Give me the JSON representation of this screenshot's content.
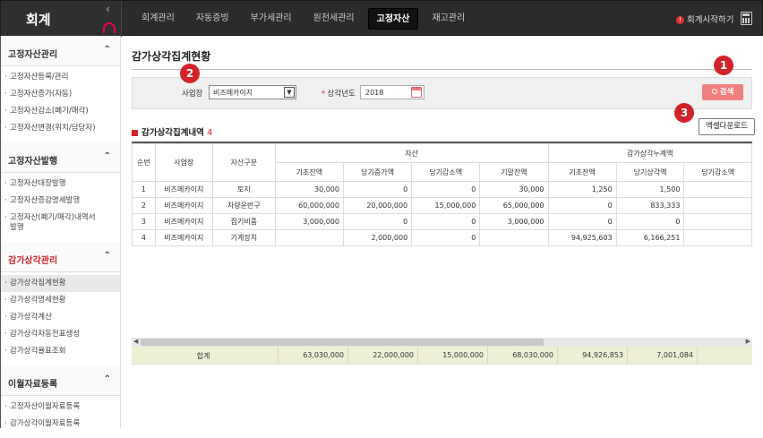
{
  "app": {
    "title": "회계"
  },
  "topnav": {
    "items": [
      "회계관리",
      "자동증빙",
      "부가세관리",
      "원천세관리",
      "고정자산",
      "재고관리"
    ],
    "active_index": 4,
    "start_link": "회계시작하기"
  },
  "sidebar": {
    "sections": [
      {
        "title": "고정자산관리",
        "items": [
          "고정자산등록/관리",
          "고정자산증가(자동)",
          "고정자산감소(폐기/매각)",
          "고정자산변경(위치/담당자)"
        ]
      },
      {
        "title": "고정자산발행",
        "items": [
          "고정자산대장발행",
          "고정자산증감명세발행",
          "고정자산(폐기/매각)내역서발행"
        ]
      },
      {
        "title": "감가상각관리",
        "items": [
          "감가상각집계현황",
          "감가상각명세현황",
          "감가상각계산",
          "감가상각자동전표생성",
          "감가상각율표조회"
        ],
        "selected": 0
      },
      {
        "title": "이월자료등록",
        "items": [
          "고정자산이월자료등록",
          "감가상각이월자료등록"
        ]
      }
    ]
  },
  "page": {
    "title": "감가상각집계현황",
    "filter": {
      "branch_label": "사업장",
      "branch_value": "비즈메카이지",
      "year_label": "상각년도",
      "year_value": "2018",
      "search_label": "검색"
    },
    "list_title": "감가상각집계내역",
    "list_count": "4",
    "excel_label": "엑셀다운로드",
    "badges": [
      "1",
      "2",
      "3"
    ]
  },
  "table": {
    "group_headers": {
      "asset": "자산",
      "dep": "감가상각누계액"
    },
    "columns": [
      "순번",
      "사업장",
      "자산구분",
      "기초잔액",
      "당기증가액",
      "당기감소액",
      "기말잔액",
      "기초잔액",
      "당기상각액",
      "당기감소액"
    ],
    "rows": [
      [
        "1",
        "비즈메카이지",
        "토지",
        "30,000",
        "0",
        "0",
        "30,000",
        "1,250",
        "1,500",
        ""
      ],
      [
        "2",
        "비즈메카이지",
        "차량운반구",
        "60,000,000",
        "20,000,000",
        "15,000,000",
        "65,000,000",
        "0",
        "833,333",
        ""
      ],
      [
        "3",
        "비즈메카이지",
        "집기비품",
        "3,000,000",
        "0",
        "0",
        "3,000,000",
        "0",
        "0",
        ""
      ],
      [
        "4",
        "비즈메카이지",
        "기계장치",
        "",
        "2,000,000",
        "0",
        "",
        "94,925,603",
        "6,166,251",
        ""
      ]
    ],
    "total": {
      "label": "합계",
      "values": [
        "63,030,000",
        "22,000,000",
        "15,000,000",
        "68,030,000",
        "94,926,853",
        "7,001,084"
      ]
    }
  }
}
